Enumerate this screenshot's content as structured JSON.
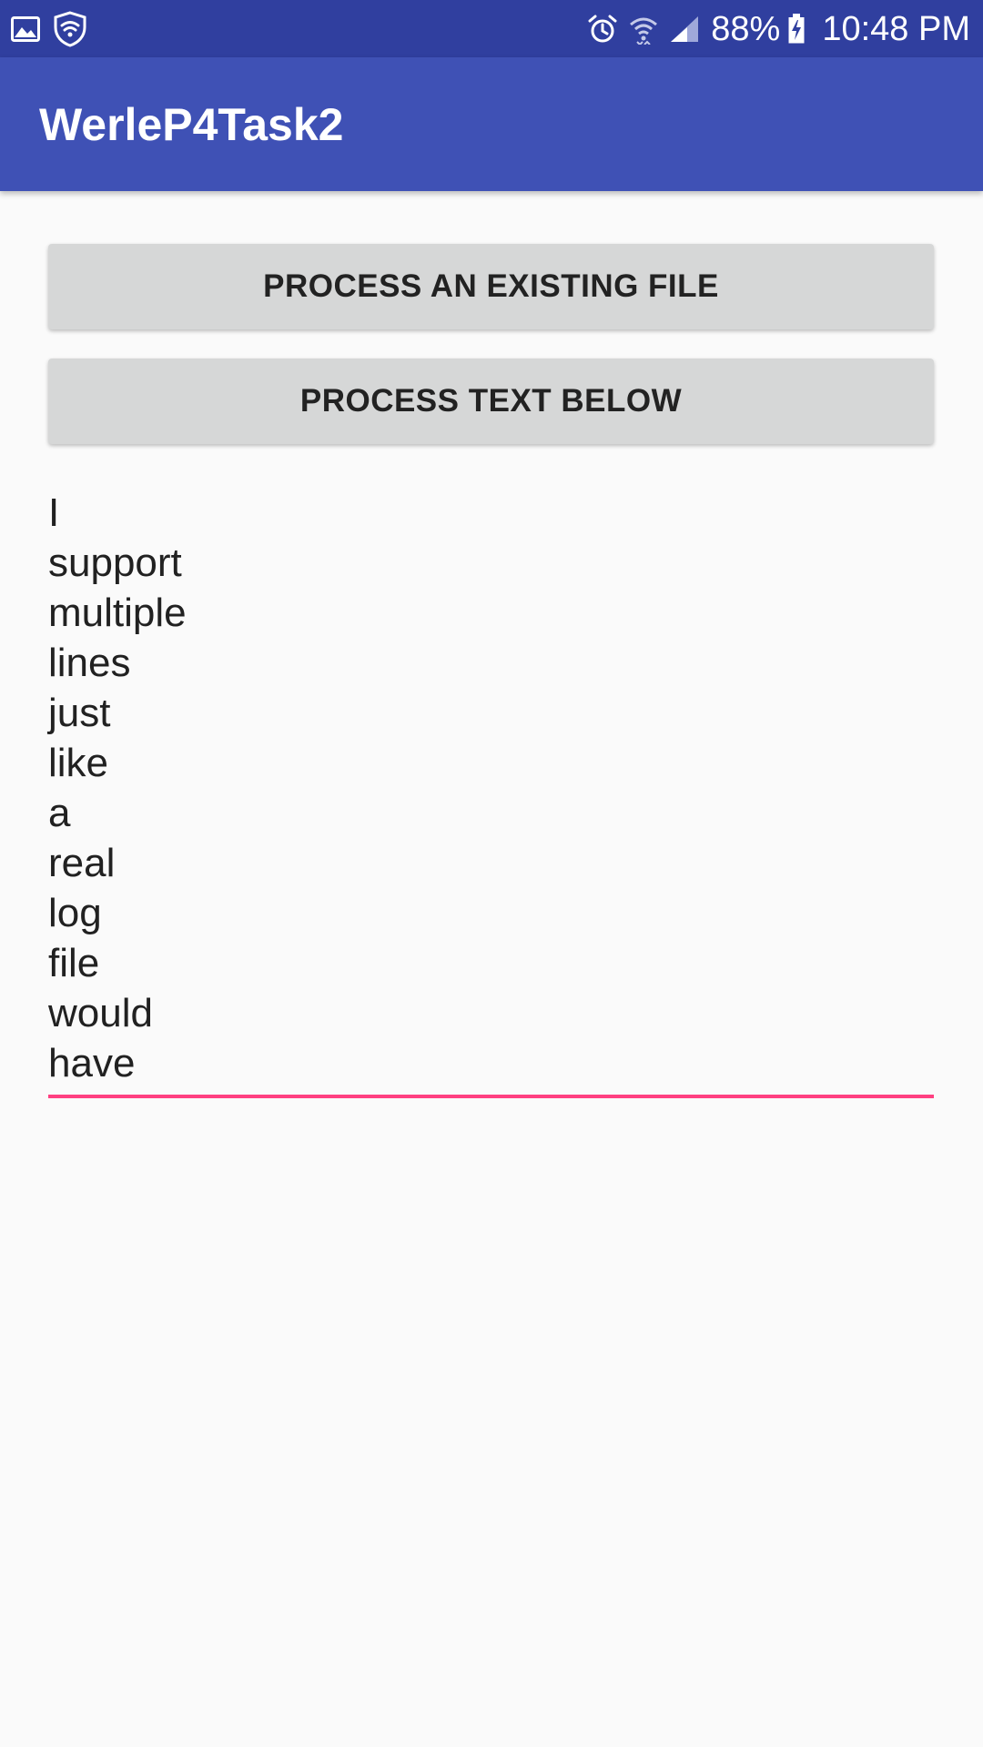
{
  "status_bar": {
    "left_icons": [
      "image-icon",
      "shield-icon"
    ],
    "right_icons": [
      "alarm-icon",
      "wifi-icon",
      "signal-icon"
    ],
    "battery_percent": "88%",
    "time": "10:48 PM",
    "colors": {
      "background": "#303f9f"
    }
  },
  "app_bar": {
    "title": "WerleP4Task2",
    "colors": {
      "background": "#3f51b5"
    }
  },
  "buttons": {
    "process_existing": "PROCESS AN EXISTING FILE",
    "process_text": "PROCESS TEXT BELOW"
  },
  "text_field": {
    "lines": [
      "I",
      "support",
      "multiple",
      "lines",
      "just",
      "like",
      "a",
      "real",
      "log",
      "file",
      "would",
      "have"
    ],
    "colors": {
      "underline": "#ff4081"
    }
  }
}
